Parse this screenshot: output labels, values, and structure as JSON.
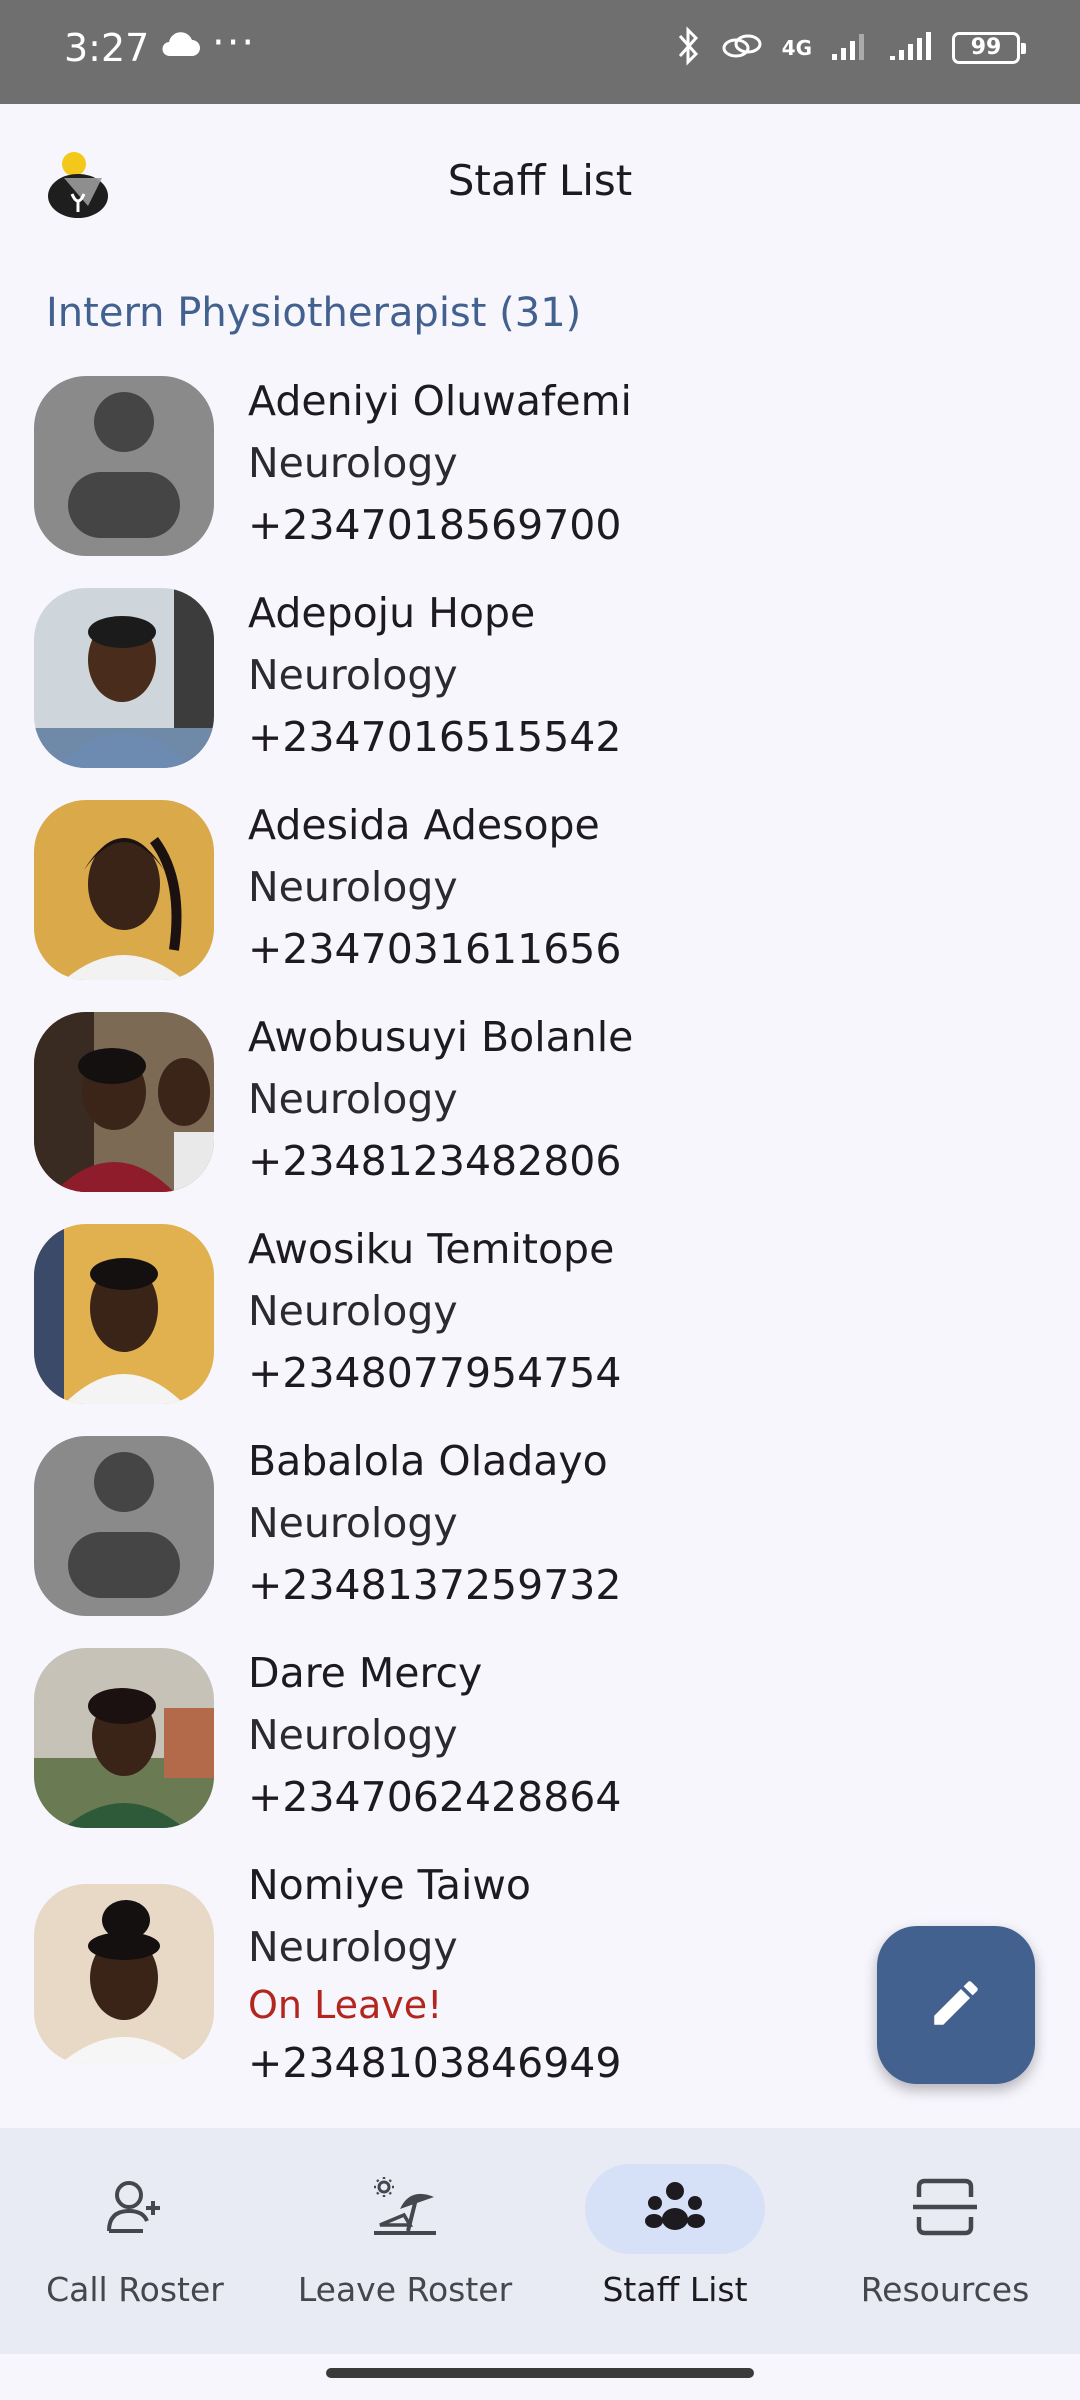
{
  "status_bar": {
    "time": "3:27",
    "dots": "···",
    "network": "4G",
    "battery": "99"
  },
  "header": {
    "title": "Staff List"
  },
  "section": {
    "title": "Intern Physiotherapist (31)"
  },
  "staff": [
    {
      "name": "Adeniyi Oluwafemi",
      "dept": "Neurology",
      "phone": "+2347018569700",
      "photo": "placeholder"
    },
    {
      "name": "Adepoju Hope",
      "dept": "Neurology",
      "phone": "+2347016515542",
      "photo": "photo"
    },
    {
      "name": "Adesida Adesope",
      "dept": "Neurology",
      "phone": "+2347031611656",
      "photo": "photo"
    },
    {
      "name": "Awobusuyi Bolanle",
      "dept": "Neurology",
      "phone": "+2348123482806",
      "photo": "photo"
    },
    {
      "name": "Awosiku Temitope",
      "dept": "Neurology",
      "phone": "+2348077954754",
      "photo": "photo"
    },
    {
      "name": "Babalola Oladayo",
      "dept": "Neurology",
      "phone": "+2348137259732",
      "photo": "placeholder"
    },
    {
      "name": "Dare Mercy",
      "dept": "Neurology",
      "phone": "+2347062428864",
      "photo": "photo"
    },
    {
      "name": "Nomiye Taiwo",
      "dept": "Neurology",
      "status": "On Leave!",
      "phone": "+2348103846949",
      "photo": "photo"
    }
  ],
  "fab": {
    "icon": "edit-pencil-icon"
  },
  "nav": {
    "items": [
      {
        "label": "Call Roster",
        "icon": "person-add-icon"
      },
      {
        "label": "Leave Roster",
        "icon": "beach-icon"
      },
      {
        "label": "Staff List",
        "icon": "groups-icon",
        "active": true
      },
      {
        "label": "Resources",
        "icon": "resources-icon"
      }
    ]
  },
  "colors": {
    "accent": "#42618f",
    "background": "#f7f6fd",
    "status_bar": "#6f6f6f",
    "nav_background": "#e9ebf4",
    "nav_active_pill": "#d6e0f7",
    "leave_status": "#b3261e"
  }
}
